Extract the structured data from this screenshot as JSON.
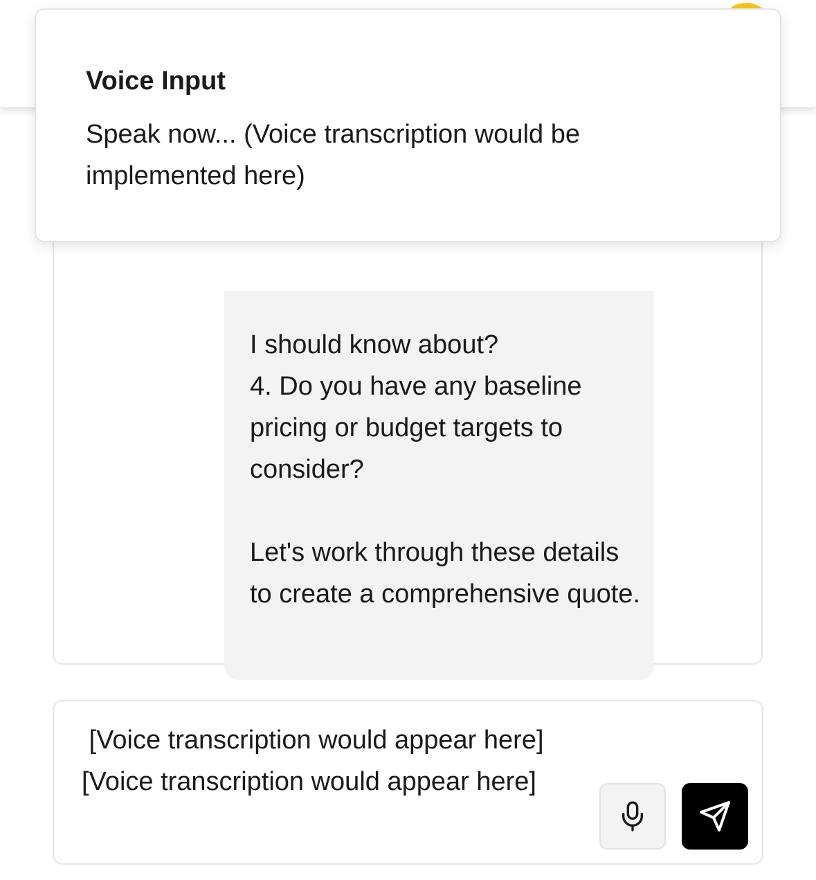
{
  "toast": {
    "title": "Voice Input",
    "message": "Speak now... (Voice transcription would be implemented here)"
  },
  "chat": {
    "assistant_message": "I should know about?\n4. Do you have any baseline pricing or budget targets to consider?\n\nLet's work through these details to create a comprehensive quote."
  },
  "composer": {
    "value": " [Voice transcription would appear here]\n[Voice transcription would appear here]",
    "mic_icon": "mic-icon",
    "send_icon": "send-icon"
  },
  "colors": {
    "avatar": "#f5c518",
    "bubble": "#f3f3f3",
    "send_button": "#000000"
  }
}
